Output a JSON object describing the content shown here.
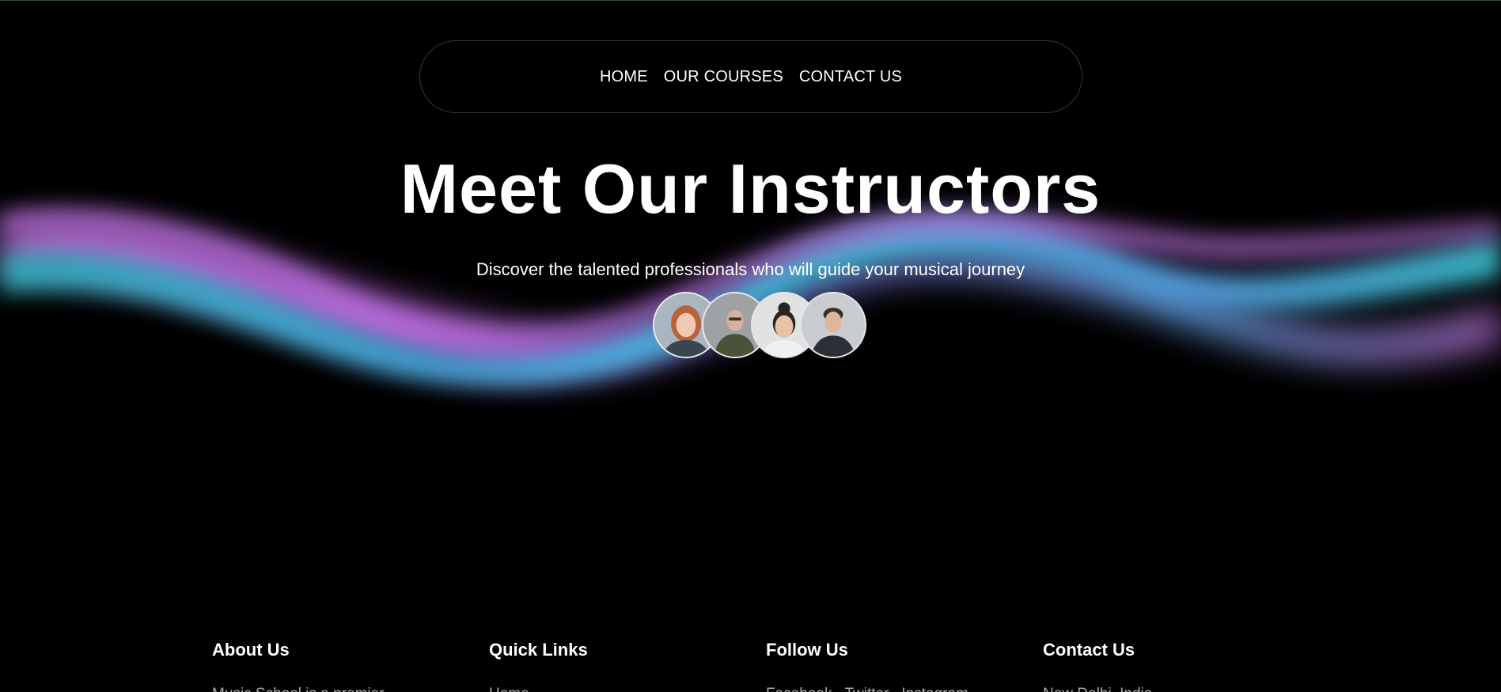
{
  "nav": {
    "links": [
      "HOME",
      "OUR COURSES",
      "CONTACT US"
    ]
  },
  "hero": {
    "title": "Meet Our Instructors",
    "subtitle": "Discover the talented professionals who will guide your musical journey"
  },
  "colors": {
    "background": "#000000",
    "wave_pink": "#c77dff",
    "wave_cyan": "#3ec6e0",
    "wave_teal": "#2fb8b0",
    "footer_text": "#a9a9a9"
  },
  "avatars": [
    {
      "name": "instructor-1-avatar"
    },
    {
      "name": "instructor-2-avatar"
    },
    {
      "name": "instructor-3-avatar"
    },
    {
      "name": "instructor-4-avatar"
    }
  ],
  "footer": {
    "about": {
      "heading": "About Us",
      "text": "Music School is a premier"
    },
    "quick_links": {
      "heading": "Quick Links",
      "first_link": "Home"
    },
    "follow": {
      "heading": "Follow Us",
      "links": [
        "Facebook",
        "Twitter",
        "Instagram"
      ]
    },
    "contact": {
      "heading": "Contact Us",
      "address": "New Delhi, India"
    }
  }
}
